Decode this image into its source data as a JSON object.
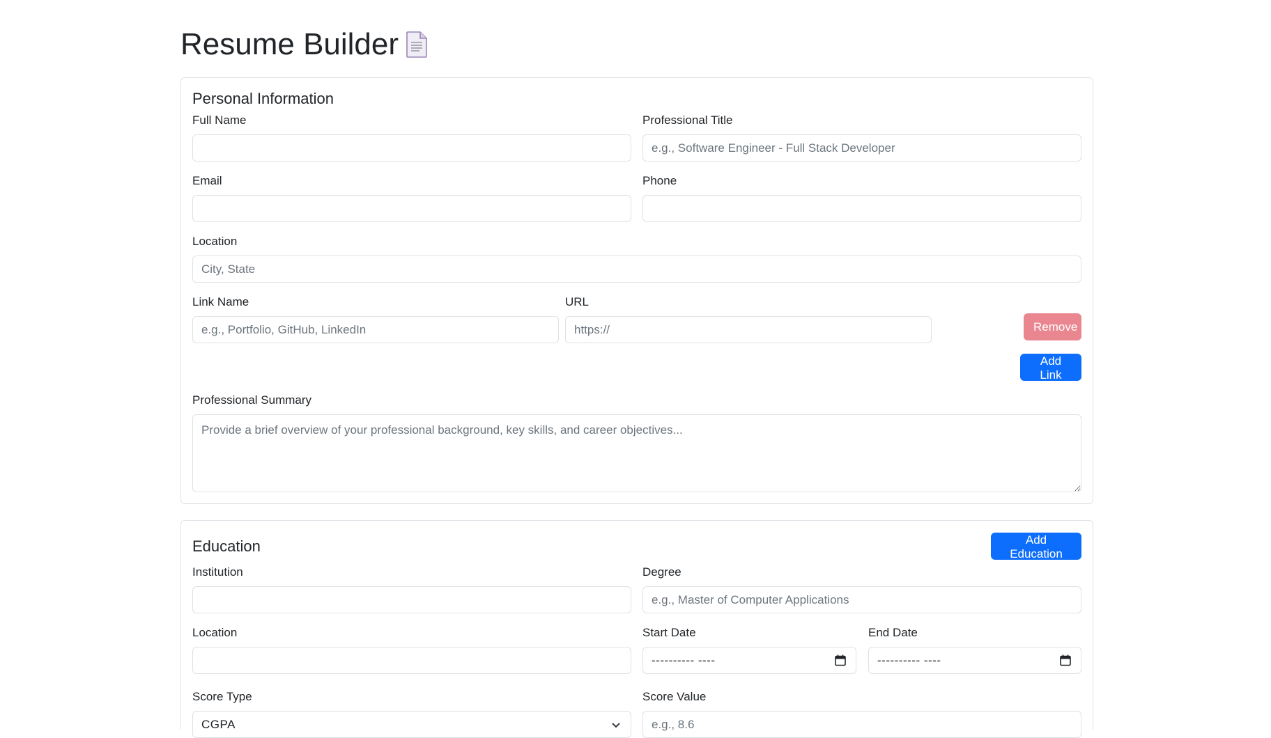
{
  "page": {
    "title": "Resume Builder",
    "title_icon": "document-icon"
  },
  "personal": {
    "heading": "Personal Information",
    "full_name_label": "Full Name",
    "full_name_value": "",
    "title_label": "Professional Title",
    "title_placeholder": "e.g., Software Engineer - Full Stack Developer",
    "email_label": "Email",
    "email_value": "",
    "phone_label": "Phone",
    "phone_value": "",
    "location_label": "Location",
    "location_placeholder": "City, State",
    "link_name_label": "Link Name",
    "link_name_placeholder": "e.g., Portfolio, GitHub, LinkedIn",
    "url_label": "URL",
    "url_placeholder": "https://",
    "remove_label": "Remove",
    "add_link_label": "Add Link",
    "summary_label": "Professional Summary",
    "summary_placeholder": "Provide a brief overview of your professional background, key skills, and career objectives..."
  },
  "education": {
    "heading": "Education",
    "add_label": "Add Education",
    "institution_label": "Institution",
    "institution_value": "",
    "degree_label": "Degree",
    "degree_placeholder": "e.g., Master of Computer Applications",
    "location_label": "Location",
    "location_value": "",
    "start_date_label": "Start Date",
    "start_date_display": "---------- ----",
    "end_date_label": "End Date",
    "end_date_display": "---------- ----",
    "score_type_label": "Score Type",
    "score_type_value": "CGPA",
    "score_value_label": "Score Value",
    "score_value_placeholder": "e.g., 8.6"
  },
  "colors": {
    "primary": "#0d6efd",
    "danger_disabled": "#ea868f",
    "border": "#dee2e6",
    "placeholder": "#6c757d"
  }
}
